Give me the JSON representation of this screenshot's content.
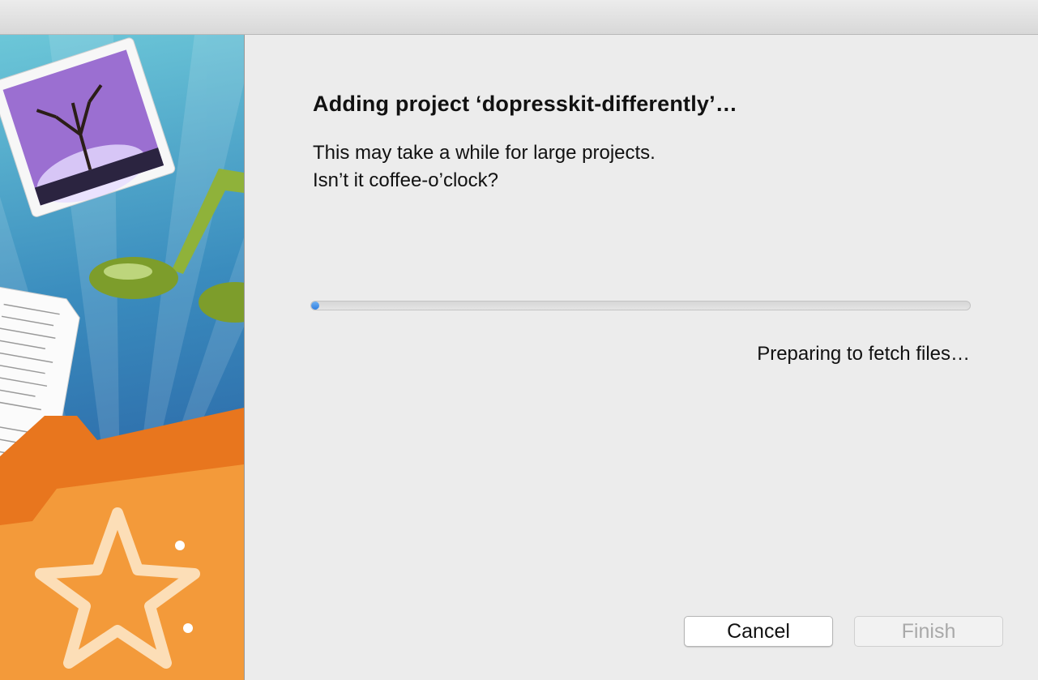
{
  "window": {
    "title": ""
  },
  "dialog": {
    "heading": "Adding project ‘dopresskit-differently’…",
    "message_line1": "This may take a while for large projects.",
    "message_line2": "Isn’t it coffee-o’clock?",
    "progress": 0.01,
    "status": "Preparing to fetch files…"
  },
  "buttons": {
    "cancel_label": "Cancel",
    "finish_label": "Finish"
  },
  "colors": {
    "accent": "#2f7fe0",
    "folder": "#f08a2c",
    "sidebar_blue": "#2c69a8"
  },
  "icons": [
    "photo-icon",
    "music-note-icon",
    "document-icon",
    "folder-icon",
    "star-icon"
  ]
}
